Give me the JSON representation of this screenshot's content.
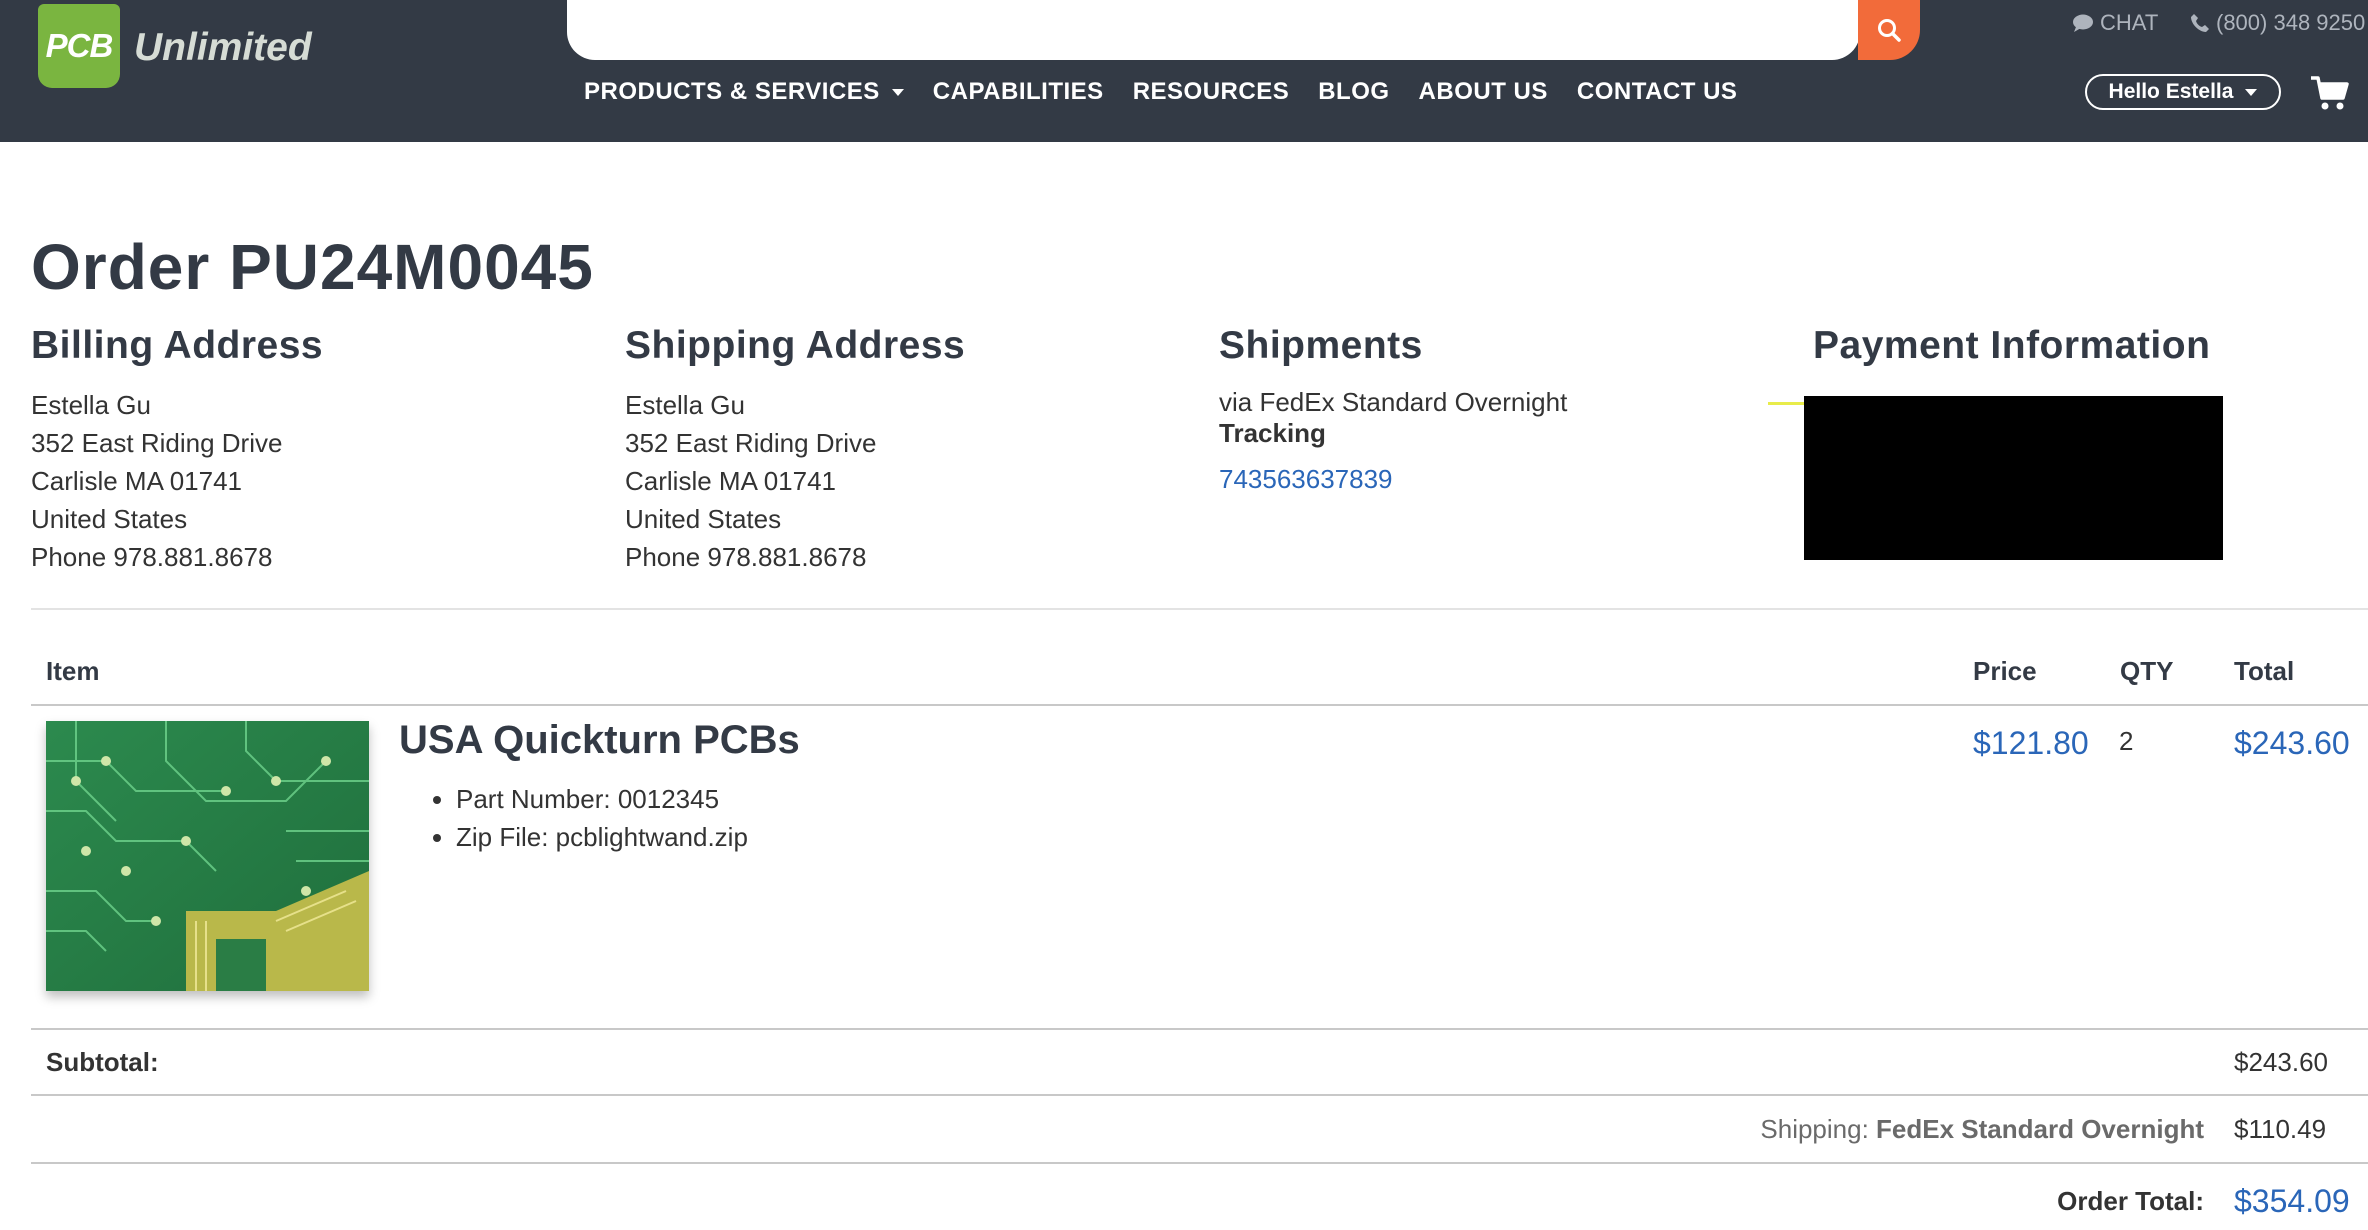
{
  "header": {
    "logo_text": "PCB",
    "logo_word": "Unlimited",
    "search": {
      "placeholder": "",
      "value": ""
    },
    "chat_label": "CHAT",
    "phone": "(800) 348 9250",
    "nav": [
      {
        "label": "PRODUCTS & SERVICES",
        "has_dropdown": true
      },
      {
        "label": "CAPABILITIES"
      },
      {
        "label": "RESOURCES"
      },
      {
        "label": "BLOG"
      },
      {
        "label": "ABOUT US"
      },
      {
        "label": "CONTACT US"
      }
    ],
    "user_greeting": "Hello Estella",
    "colors": {
      "bar": "#333a45",
      "accent": "#f26b3a",
      "brand": "#7ab540",
      "link": "#2a66b8"
    }
  },
  "order": {
    "title": "Order PU24M0045",
    "billing": {
      "heading": "Billing Address",
      "lines": [
        "Estella Gu",
        "352 East Riding Drive",
        "Carlisle MA 01741",
        "United States",
        "Phone 978.881.8678"
      ]
    },
    "shipping": {
      "heading": "Shipping Address",
      "lines": [
        "Estella Gu",
        "352 East Riding Drive",
        "Carlisle MA 01741",
        "United States",
        "Phone 978.881.8678"
      ]
    },
    "shipments": {
      "heading": "Shipments",
      "via": "via FedEx Standard Overnight",
      "tracking_label": "Tracking",
      "tracking_number": "743563637839"
    },
    "payment": {
      "heading": "Payment Information"
    }
  },
  "table": {
    "headers": {
      "item": "Item",
      "price": "Price",
      "qty": "QTY",
      "total": "Total"
    },
    "rows": [
      {
        "name": "USA Quickturn PCBs",
        "attributes": [
          "Part Number: 0012345",
          "Zip File: pcblightwand.zip"
        ],
        "price": "$121.80",
        "qty": "2",
        "total": "$243.60"
      }
    ]
  },
  "summary": {
    "subtotal_label": "Subtotal:",
    "subtotal_value": "$243.60",
    "shipping_prefix": "Shipping:",
    "shipping_method": "FedEx Standard Overnight",
    "shipping_value": "$110.49",
    "order_total_label": "Order Total:",
    "order_total_value": "$354.09"
  }
}
